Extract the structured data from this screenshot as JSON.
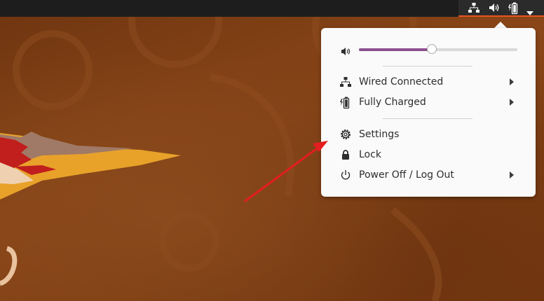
{
  "topbar": {
    "status_icons": [
      "network-wired-icon",
      "speaker-volume-icon",
      "battery-charging-icon",
      "menu-caret-icon"
    ]
  },
  "system_menu": {
    "volume": {
      "icon": "speaker-volume-icon",
      "level": 0.46,
      "fill_color": "#8b4f8e"
    },
    "items": [
      {
        "icon": "network-wired-icon",
        "label": "Wired Connected",
        "has_submenu": true
      },
      {
        "icon": "battery-charging-icon",
        "label": "Fully Charged",
        "has_submenu": true
      },
      {
        "icon": "gear-icon",
        "label": "Settings",
        "has_submenu": false
      },
      {
        "icon": "lock-icon",
        "label": "Lock",
        "has_submenu": false
      },
      {
        "icon": "power-icon",
        "label": "Power Off / Log Out",
        "has_submenu": true
      }
    ]
  },
  "colors": {
    "accent": "#e95420",
    "annotation_arrow": "#e31e1e",
    "menu_background": "#fafafa"
  }
}
